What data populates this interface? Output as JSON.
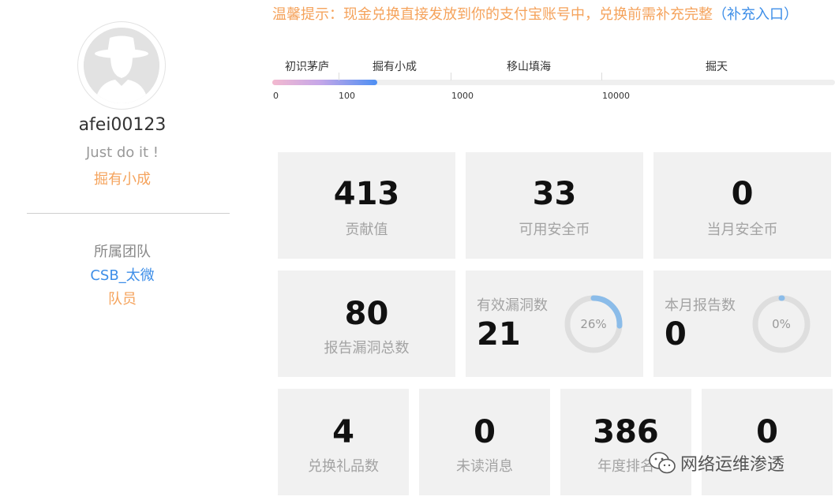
{
  "notice": {
    "text": "温馨提示：现金兑换直接发放到你的支付宝账号中，兑换前需补充完整",
    "link": "（补充入口）"
  },
  "profile": {
    "username": "afei00123",
    "motto": "Just do it !",
    "level": "掘有小成",
    "team_label": "所属团队",
    "team_name": "CSB_太微",
    "team_role": "队员"
  },
  "levels": {
    "names": [
      "初识茅庐",
      "掘有小成",
      "移山填海",
      "掘天"
    ],
    "thresholds": [
      "0",
      "100",
      "1000",
      "10000"
    ],
    "current_value": 413
  },
  "stats": {
    "contribution": {
      "value": "413",
      "label": "贡献值"
    },
    "available_coins": {
      "value": "33",
      "label": "可用安全币"
    },
    "month_coins": {
      "value": "0",
      "label": "当月安全币"
    },
    "total_reports": {
      "value": "80",
      "label": "报告漏洞总数"
    },
    "valid_vulns": {
      "value": "21",
      "label": "有效漏洞数",
      "percent_text": "26%",
      "percent": 0.26
    },
    "month_reports": {
      "value": "0",
      "label": "本月报告数",
      "percent_text": "0%",
      "percent": 0.0
    },
    "gifts": {
      "value": "4",
      "label": "兑换礼品数"
    },
    "unread": {
      "value": "0",
      "label": "未读消息"
    },
    "annual_rank": {
      "value": "386",
      "label": "年度排名"
    },
    "last": {
      "value": "0",
      "label": ""
    }
  },
  "watermark": {
    "text": "网络运维渗透"
  },
  "colors": {
    "orange": "#f5a35c",
    "blue": "#3d8ee8",
    "card_bg": "#f1f1f1",
    "ring_fill": "#8bbce9",
    "ring_track": "#dedede"
  }
}
